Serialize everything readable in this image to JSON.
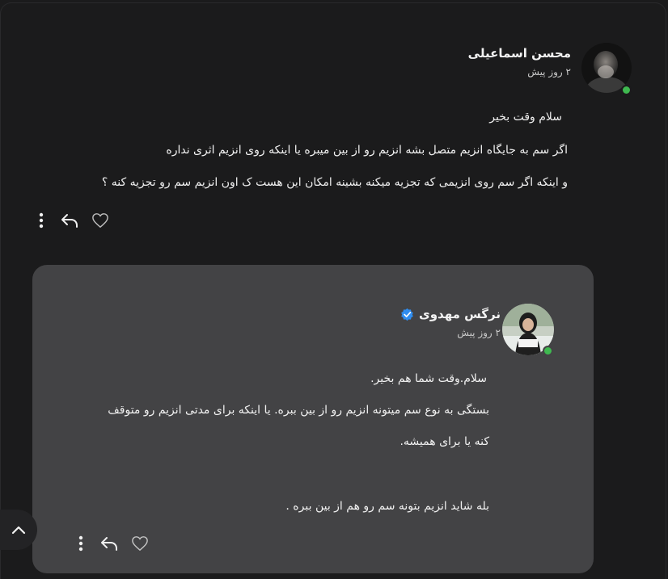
{
  "post": {
    "author": "محسن اسماعیلی",
    "time": "۲ روز پیش",
    "lines": [
      "سلام وقت بخیر",
      "اگر سم به جایگاه انزیم متصل بشه انزیم رو از بین میبره یا اینکه روی انزیم اثری نداره",
      "و اینکه اگر سم روی انزیمی که تجزیه میکنه بشینه امکان این هست ک اون انزیم سم رو تجزیه کنه ؟"
    ]
  },
  "reply": {
    "author": "نرگس مهدوی",
    "verified": true,
    "time": "۲ روز پیش",
    "lines": [
      "سلام.وقت شما هم بخیر.",
      "بستگی به نوع سم میتونه انزیم رو از بین ببره. یا اینکه برای مدتی انزیم رو متوقف",
      "کنه یا برای همیشه.",
      "بله شاید انزیم بتونه سم رو هم از بین ببره ."
    ]
  },
  "icons": {
    "more": "more-vertical-icon",
    "reply": "reply-arrow-icon",
    "like": "heart-outline-icon",
    "scroll": "chevron-up-icon"
  },
  "colors": {
    "background": "#1b1b1c",
    "reply_card": "#434345",
    "online": "#3fb950",
    "verified": "#2f8df0"
  }
}
